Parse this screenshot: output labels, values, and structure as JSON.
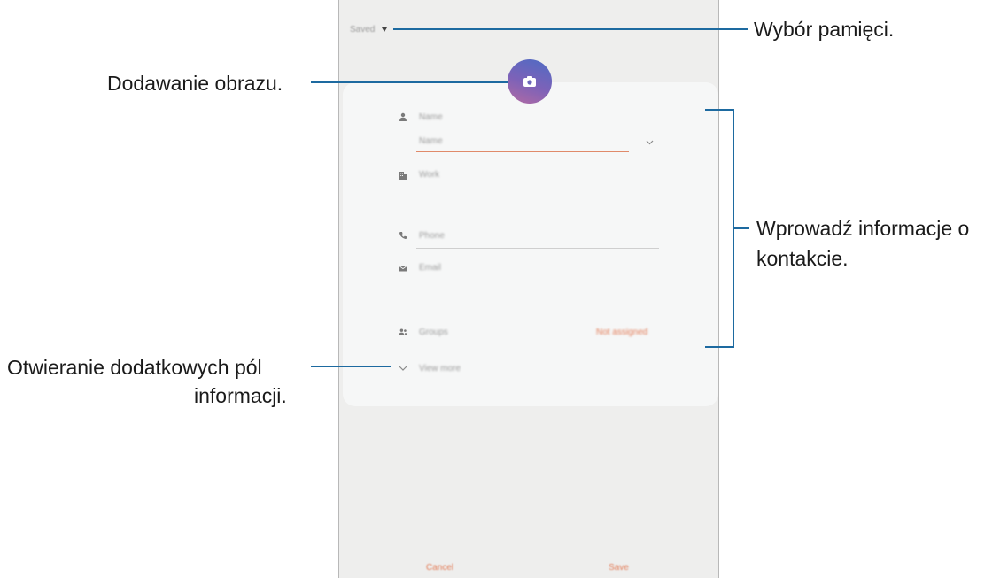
{
  "screen": {
    "storage_label": "Saved",
    "name_section_label": "Name",
    "name_field_placeholder": "Name",
    "work_label": "Work",
    "phone_placeholder": "Phone",
    "email_placeholder": "Email",
    "groups_label": "Groups",
    "groups_value": "Not assigned",
    "view_more_label": "View more",
    "cancel_label": "Cancel",
    "save_label": "Save",
    "accent_color": "#e27a55"
  },
  "annotations": {
    "storage": "Wybór pamięci.",
    "add_image": "Dodawanie obrazu.",
    "enter_info_line1": "Wprowadź informacje o",
    "enter_info_line2": "kontakcie.",
    "more_fields_line1": "Otwieranie dodatkowych pól",
    "more_fields_line2": "informacji."
  },
  "icons": [
    "person-icon",
    "building-icon",
    "phone-icon",
    "email-icon",
    "group-icon",
    "chevron-down-icon",
    "camera-icon",
    "dropdown-caret-icon"
  ]
}
